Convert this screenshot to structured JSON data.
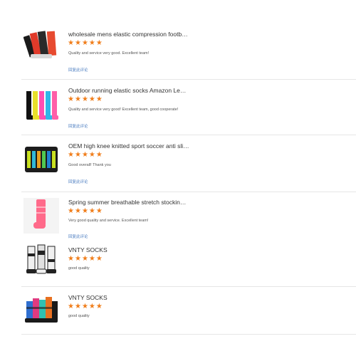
{
  "reviews": [
    {
      "title": "wholesale mens elastic compression football t...",
      "review": "Quality and service very good. Excellent team!",
      "link_label": "回复此评论",
      "rating": 5,
      "sock_colors": [
        "#1a1a1a",
        "#e03a2a",
        "#2a2a2a",
        "#d9d9d9"
      ]
    },
    {
      "title": "Outdoor running elastic socks Amazon Leggin...",
      "review": "Quality and service very good! Excellent team, good cooperate!",
      "link_label": "回复此评论",
      "rating": 5,
      "sock_colors": [
        "#111111",
        "#e8e02a",
        "#ff4fb2",
        "#2fb8e8",
        "#ff5fa8"
      ]
    },
    {
      "title": "OEM high knee knitted sport soccer anti slip ...",
      "review": "Good overall! Thank you",
      "link_label": "回复此评论",
      "rating": 5,
      "sock_colors": [
        "#1c1c1c",
        "#c8e020",
        "#30b8d8",
        "#e8a020",
        "#50c850",
        "#2080d0"
      ]
    },
    {
      "title": "Spring summer breathable stretch stockings c...",
      "review": "Very good quality and service. Excellent team!",
      "link_label": "回复此评论",
      "rating": 5,
      "sock_colors": [
        "#ff6a8a"
      ]
    },
    {
      "title": "VNTY SOCKS",
      "review": "good quality",
      "link_label": "",
      "rating": 5,
      "sock_colors": [
        "#f0f0f0",
        "#222222",
        "#e0e0e0"
      ]
    },
    {
      "title": "VNTY SOCKS",
      "review": "good quality",
      "link_label": "",
      "rating": 5,
      "sock_colors": [
        "#2f6fd0",
        "#e03a80",
        "#30c0b0",
        "#e87020",
        "#1a1a1a"
      ]
    }
  ]
}
